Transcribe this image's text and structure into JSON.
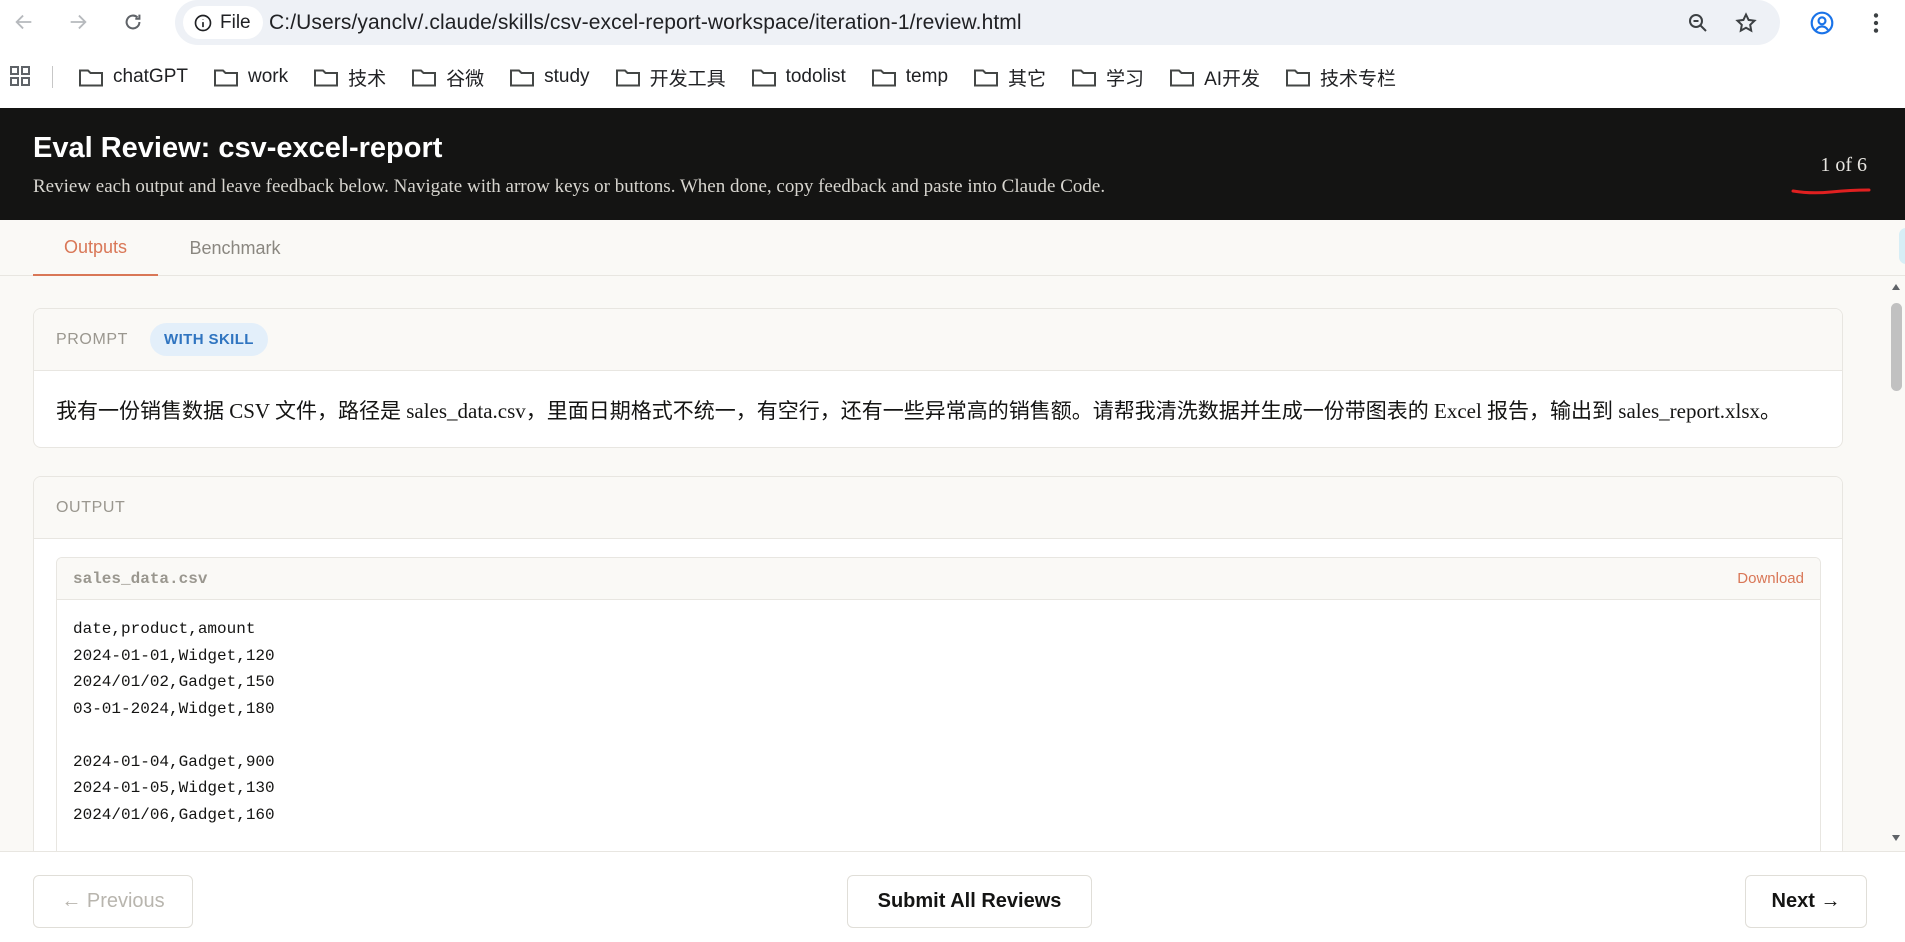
{
  "browser": {
    "file_chip_label": "File",
    "url": "C:/Users/yanclv/.claude/skills/csv-excel-report-workspace/iteration-1/review.html",
    "bookmarks": [
      "chatGPT",
      "work",
      "技术",
      "谷微",
      "study",
      "开发工具",
      "todolist",
      "temp",
      "其它",
      "学习",
      "AI开发",
      "技术专栏"
    ]
  },
  "header": {
    "title": "Eval Review: csv-excel-report",
    "subtitle": "Review each output and leave feedback below. Navigate with arrow keys or buttons. When done, copy feedback and paste into Claude Code.",
    "counter": "1 of 6"
  },
  "tabs": [
    {
      "label": "Outputs",
      "active": true
    },
    {
      "label": "Benchmark",
      "active": false
    }
  ],
  "prompt_card": {
    "label": "PROMPT",
    "badge": "WITH SKILL",
    "text": "我有一份销售数据 CSV 文件，路径是 sales_data.csv，里面日期格式不统一，有空行，还有一些异常高的销售额。请帮我清洗数据并生成一份带图表的 Excel 报告，输出到 sales_report.xlsx。"
  },
  "output_card": {
    "label": "OUTPUT",
    "file": {
      "name": "sales_data.csv",
      "download_label": "Download",
      "lines": [
        "date,product,amount",
        "2024-01-01,Widget,120",
        "2024/01/02,Gadget,150",
        "03-01-2024,Widget,180",
        "",
        "2024-01-04,Gadget,900",
        "2024-01-05,Widget,130",
        "2024/01/06,Gadget,160"
      ]
    }
  },
  "footer": {
    "previous_label": "← Previous",
    "submit_label": "Submit All Reviews",
    "next_label": "Next →"
  },
  "colors": {
    "accent": "#d97757",
    "header_bg": "#141413",
    "badge_bg": "#e3effa",
    "badge_text": "#2f74c0"
  }
}
